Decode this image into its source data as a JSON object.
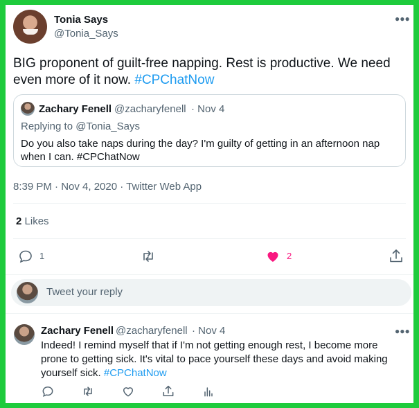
{
  "tweet": {
    "author_name": "Tonia Says",
    "author_handle": "@Tonia_Says",
    "text_plain": "BIG proponent of guilt-free napping.  Rest is productive.  We  need even more of it now. ",
    "hashtag": "#CPChatNow",
    "timestamp": "8:39 PM · Nov 4, 2020 · Twitter Web App",
    "likes_count": "2",
    "likes_label": "Likes",
    "reply_count": "1",
    "like_action_count": "2"
  },
  "quote": {
    "author_name": "Zachary Fenell",
    "author_handle": "@zacharyfenell",
    "date": "· Nov 4",
    "replying_to": "Replying to @Tonia_Says",
    "text": "Do you also take naps during the day? I'm guilty of getting in an afternoon nap when I can. #CPChatNow"
  },
  "compose": {
    "placeholder": "Tweet your reply"
  },
  "reply": {
    "author_name": "Zachary Fenell",
    "author_handle": "@zacharyfenell",
    "date": "· Nov 4",
    "text_plain": "Indeed! I remind myself that if I'm not getting enough rest, I become more prone to getting sick. It's vital to pace yourself these days and avoid making yourself sick. ",
    "hashtag": "#CPChatNow"
  },
  "icons": {
    "more": "more-horizontal-icon",
    "reply": "reply-icon",
    "retweet": "retweet-icon",
    "like": "heart-icon",
    "share": "share-icon",
    "analytics": "analytics-icon"
  },
  "colors": {
    "border_green": "#1ecb3c",
    "link_blue": "#1d9bf0",
    "like_pink": "#f91880",
    "muted": "#536471"
  }
}
